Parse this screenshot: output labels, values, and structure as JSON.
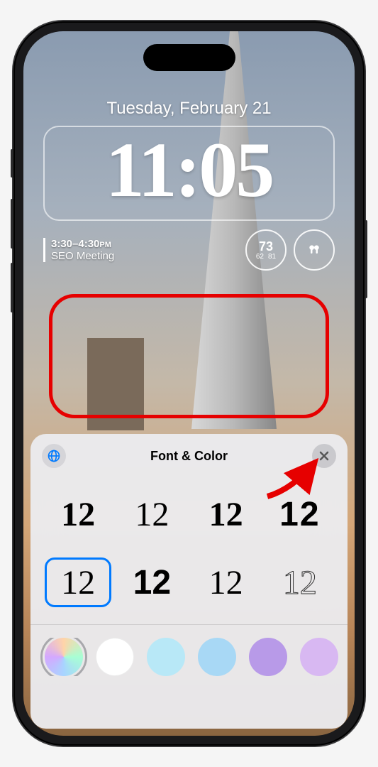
{
  "lockscreen": {
    "date": "Tuesday, February 21",
    "time": "11:05"
  },
  "widgets": {
    "calendar": {
      "time_range": "3:30–4:30",
      "period": "PM",
      "title": "SEO Meeting"
    },
    "weather": {
      "current": "73",
      "low": "62",
      "high": "81"
    }
  },
  "sheet": {
    "title": "Font & Color",
    "globe_icon": "globe-icon",
    "close_icon": "close-icon",
    "font_sample": "12",
    "fonts": [
      {
        "id": 0,
        "selected": false
      },
      {
        "id": 1,
        "selected": false
      },
      {
        "id": 2,
        "selected": false
      },
      {
        "id": 3,
        "selected": false
      },
      {
        "id": 4,
        "selected": true
      },
      {
        "id": 5,
        "selected": false
      },
      {
        "id": 6,
        "selected": false
      },
      {
        "id": 7,
        "selected": false
      }
    ],
    "colors": [
      {
        "hex": "gradient",
        "selected": true
      },
      {
        "hex": "#ffffff",
        "selected": false
      },
      {
        "hex": "#b8e8f7",
        "selected": false
      },
      {
        "hex": "#a8d8f5",
        "selected": false
      },
      {
        "hex": "#b89ae8",
        "selected": false
      },
      {
        "hex": "#d8b8f2",
        "selected": false
      },
      {
        "hex": "#f5b8d8",
        "selected": false
      }
    ]
  }
}
